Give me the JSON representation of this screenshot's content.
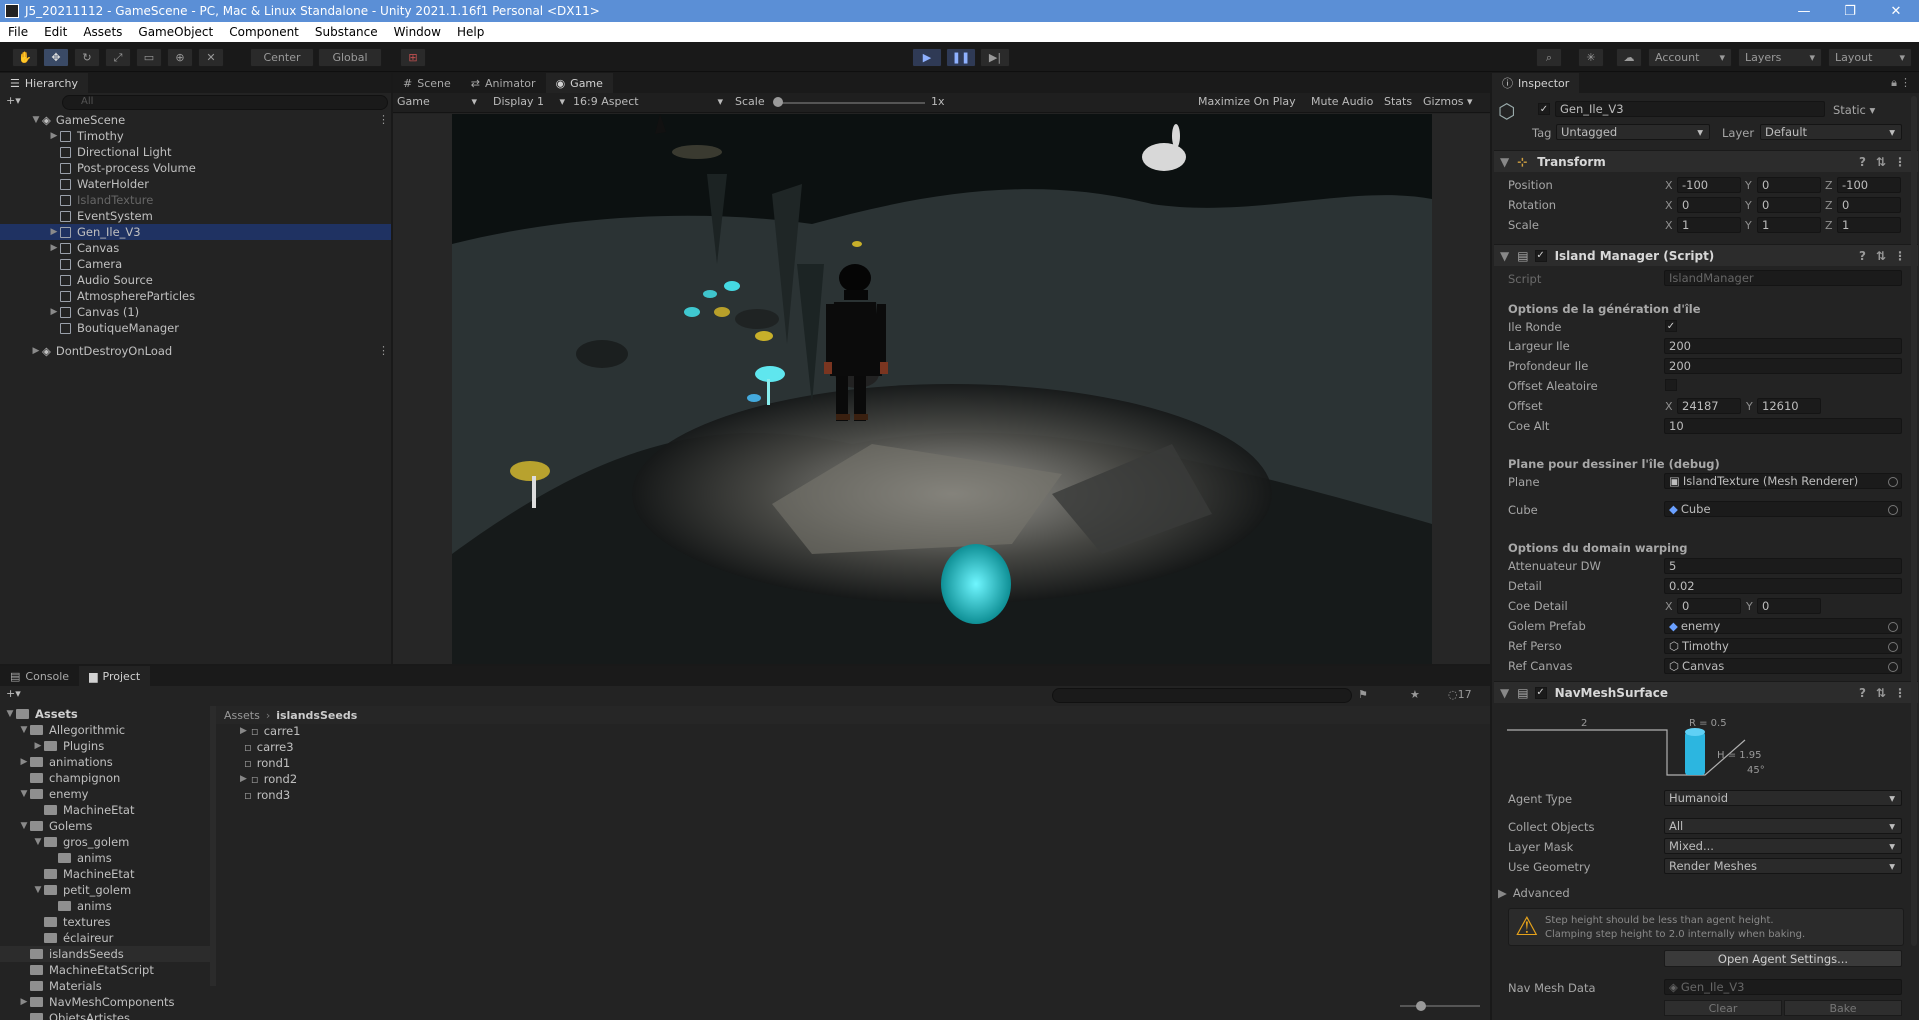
{
  "window": {
    "title": "J5_20211112 - GameScene - PC, Mac & Linux Standalone - Unity 2021.1.16f1 Personal <DX11>",
    "controls": [
      "—",
      "❐",
      "✕"
    ]
  },
  "menu": [
    "File",
    "Edit",
    "Assets",
    "GameObject",
    "Component",
    "Substance",
    "Window",
    "Help"
  ],
  "toolbar": {
    "pivot": "Center",
    "space": "Global",
    "account": "Account",
    "layers": "Layers",
    "layout": "Layout"
  },
  "hierarchy": {
    "tab": "Hierarchy",
    "search_placeholder": "All",
    "scene": "GameScene",
    "items": [
      {
        "label": "Timothy",
        "arrow": true,
        "dim": false
      },
      {
        "label": "Directional Light",
        "arrow": false,
        "dim": false
      },
      {
        "label": "Post-process Volume",
        "arrow": false,
        "dim": false
      },
      {
        "label": "WaterHolder",
        "arrow": false,
        "dim": false
      },
      {
        "label": "IslandTexture",
        "arrow": false,
        "dim": true
      },
      {
        "label": "EventSystem",
        "arrow": false,
        "dim": false
      },
      {
        "label": "Gen_Ile_V3",
        "arrow": true,
        "dim": false,
        "selected": true
      },
      {
        "label": "Canvas",
        "arrow": true,
        "dim": false
      },
      {
        "label": "Camera",
        "arrow": false,
        "dim": false
      },
      {
        "label": "Audio Source",
        "arrow": false,
        "dim": false
      },
      {
        "label": "AtmosphereParticles",
        "arrow": false,
        "dim": false
      },
      {
        "label": "Canvas (1)",
        "arrow": true,
        "dim": false
      },
      {
        "label": "BoutiqueManager",
        "arrow": false,
        "dim": false
      }
    ],
    "dontdestroy": "DontDestroyOnLoad"
  },
  "game_view": {
    "tabs": [
      "Scene",
      "Animator",
      "Game"
    ],
    "display_mode": "Game",
    "display": "Display 1",
    "aspect": "16:9 Aspect",
    "scale_label": "Scale",
    "scale_value": "1x",
    "maximize": "Maximize On Play",
    "mute": "Mute Audio",
    "stats": "Stats",
    "gizmos": "Gizmos"
  },
  "bottom": {
    "tabs": [
      "Console",
      "Project"
    ],
    "breadcrumb_root": "Assets",
    "breadcrumb_leaf": "islandsSeeds",
    "hidden_count": "17",
    "tree": [
      {
        "label": "Assets",
        "depth": 0,
        "arrow": "▼",
        "bold": true
      },
      {
        "label": "Allegorithmic",
        "depth": 1,
        "arrow": "▼"
      },
      {
        "label": "Plugins",
        "depth": 2,
        "arrow": "▶"
      },
      {
        "label": "animations",
        "depth": 1,
        "arrow": "▶"
      },
      {
        "label": "champignon",
        "depth": 1,
        "arrow": ""
      },
      {
        "label": "enemy",
        "depth": 1,
        "arrow": "▼"
      },
      {
        "label": "MachineEtat",
        "depth": 2,
        "arrow": ""
      },
      {
        "label": "Golems",
        "depth": 1,
        "arrow": "▼"
      },
      {
        "label": "gros_golem",
        "depth": 2,
        "arrow": "▼"
      },
      {
        "label": "anims",
        "depth": 3,
        "arrow": ""
      },
      {
        "label": "MachineEtat",
        "depth": 2,
        "arrow": ""
      },
      {
        "label": "petit_golem",
        "depth": 2,
        "arrow": "▼"
      },
      {
        "label": "anims",
        "depth": 3,
        "arrow": ""
      },
      {
        "label": "textures",
        "depth": 2,
        "arrow": ""
      },
      {
        "label": "éclaireur",
        "depth": 2,
        "arrow": ""
      },
      {
        "label": "islandsSeeds",
        "depth": 1,
        "arrow": "",
        "selected": true
      },
      {
        "label": "MachineEtatScript",
        "depth": 1,
        "arrow": ""
      },
      {
        "label": "Materials",
        "depth": 1,
        "arrow": ""
      },
      {
        "label": "NavMeshComponents",
        "depth": 1,
        "arrow": "▶"
      },
      {
        "label": "ObjetsArtistes",
        "depth": 1,
        "arrow": ""
      }
    ],
    "files": [
      "carre1",
      "carre3",
      "rond1",
      "rond2",
      "rond3"
    ]
  },
  "inspector": {
    "tab": "Inspector",
    "object_name": "Gen_Ile_V3",
    "static_label": "Static",
    "tag_label": "Tag",
    "tag_value": "Untagged",
    "layer_label": "Layer",
    "layer_value": "Default",
    "transform": {
      "title": "Transform",
      "position_label": "Position",
      "position": [
        "-100",
        "0",
        "-100"
      ],
      "rotation_label": "Rotation",
      "rotation": [
        "0",
        "0",
        "0"
      ],
      "scale_label": "Scale",
      "scale": [
        "1",
        "1",
        "1"
      ]
    },
    "island": {
      "title": "Island Manager (Script)",
      "script_label": "Script",
      "script_value": "IslandManager",
      "section1": "Options de la génération d'île",
      "ile_ronde": "Ile Ronde",
      "largeur_label": "Largeur Ile",
      "largeur": "200",
      "profondeur_label": "Profondeur Ile",
      "profondeur": "200",
      "offset_aleatoire": "Offset Aleatoire",
      "offset_label": "Offset",
      "offset_x": "24187",
      "offset_y": "12610",
      "coe_alt_label": "Coe Alt",
      "coe_alt": "10",
      "section2": "Plane pour dessiner l'île (debug)",
      "plane_label": "Plane",
      "plane_value": "IslandTexture (Mesh Renderer)",
      "cube_label": "Cube",
      "cube_value": "Cube",
      "section3": "Options du domain warping",
      "att_label": "Attenuateur DW",
      "att": "5",
      "detail_label": "Detail",
      "detail": "0.02",
      "coe_detail_label": "Coe Detail",
      "coe_detail_x": "0",
      "coe_detail_y": "0",
      "golem_label": "Golem Prefab",
      "golem": "enemy",
      "refperso_label": "Ref Perso",
      "refperso": "Timothy",
      "refcanvas_label": "Ref Canvas",
      "refcanvas": "Canvas"
    },
    "navmesh": {
      "title": "NavMeshSurface",
      "r_label": "R = 0.5",
      "h_label": "H = 1.95",
      "step_label": "2",
      "angle_label": "45°",
      "agent_type_label": "Agent Type",
      "agent_type": "Humanoid",
      "collect_label": "Collect Objects",
      "collect": "All",
      "layer_mask_label": "Layer Mask",
      "layer_mask": "Mixed...",
      "use_geom_label": "Use Geometry",
      "use_geom": "Render Meshes",
      "advanced": "Advanced",
      "warning_line1": "Step height should be less than agent height.",
      "warning_line2": "Clamping step height to 2.0 internally when baking.",
      "open_agent": "Open Agent Settings...",
      "navmesh_data_label": "Nav Mesh Data",
      "navmesh_data": "Gen_Ile_V3",
      "clear": "Clear",
      "bake": "Bake"
    }
  },
  "colors": {
    "selection": "#1f3262",
    "accent": "#3a79d8",
    "glow": "#27c2c9"
  }
}
